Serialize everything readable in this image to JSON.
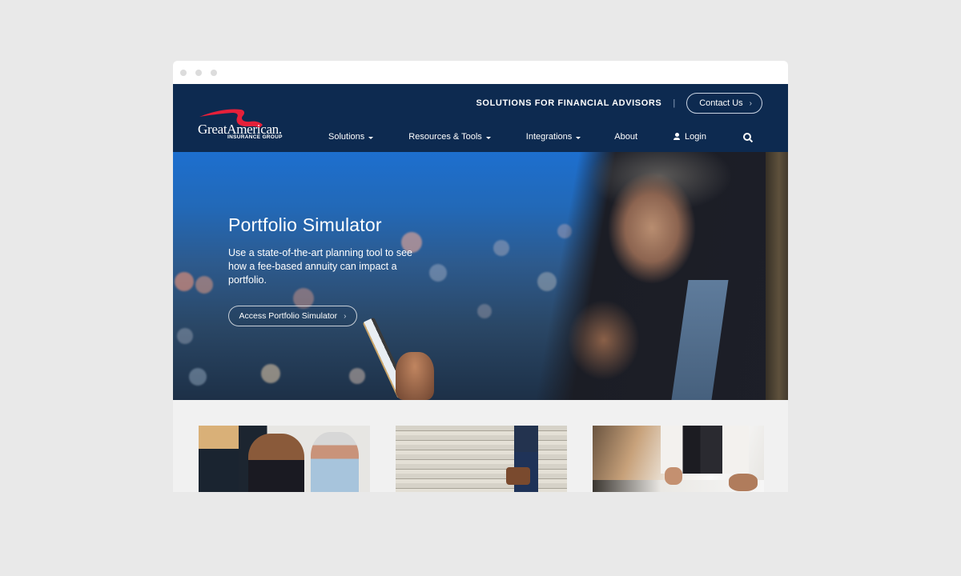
{
  "browser": {
    "window_controls": [
      "close",
      "minimize",
      "maximize"
    ]
  },
  "header": {
    "logo": {
      "line1_great": "Great",
      "line1_american": "American.",
      "line2": "INSURANCE GROUP",
      "brand_red": "#e5203a"
    },
    "utility": {
      "tagline": "SOLUTIONS FOR FINANCIAL ADVISORS",
      "separator": "|",
      "contact_label": "Contact Us",
      "contact_chevron": "›"
    },
    "nav": [
      {
        "label": "Solutions",
        "dropdown": true
      },
      {
        "label": "Resources & Tools",
        "dropdown": true
      },
      {
        "label": "Integrations",
        "dropdown": true
      },
      {
        "label": "About",
        "dropdown": false
      },
      {
        "label": "Login",
        "icon": "user-icon"
      },
      {
        "icon": "search-icon"
      }
    ],
    "background_color": "#0d2a50"
  },
  "hero": {
    "title": "Portfolio Simulator",
    "description": "Use a state-of-the-art planning tool to see how a fee-based annuity can impact a portfolio.",
    "cta_label": "Access Portfolio Simulator",
    "cta_chevron": "›",
    "image_alt": "Man looking at tablet at night with city bokeh lights"
  },
  "cards": [
    {
      "image_alt": "Three businesswomen reviewing documents"
    },
    {
      "image_alt": "Businessman walking up stone stairs with briefcase"
    },
    {
      "image_alt": "Professional signing a document at a desk"
    }
  ]
}
